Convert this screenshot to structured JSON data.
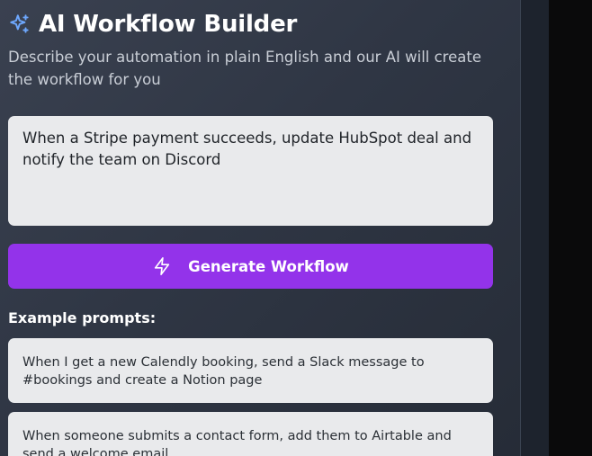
{
  "header": {
    "title": "AI Workflow Builder",
    "icon": "sparkle-icon",
    "subtitle": "Describe your automation in plain English and our AI will create the workflow for you"
  },
  "prompt": {
    "value": "When a Stripe payment succeeds, update HubSpot deal and notify the team on Discord"
  },
  "generate_button": {
    "label": "Generate Workflow",
    "icon": "lightning-bolt-icon"
  },
  "examples": {
    "heading": "Example prompts:",
    "items": [
      {
        "text": "When I get a new Calendly booking, send a Slack message to #bookings and create a Notion page"
      },
      {
        "text": "When someone submits a contact form, add them to Airtable and send a welcome email"
      }
    ]
  },
  "colors": {
    "accent": "#9333ea",
    "icon_blue": "#6ea8fe",
    "card_bg": "#e9eaec"
  }
}
